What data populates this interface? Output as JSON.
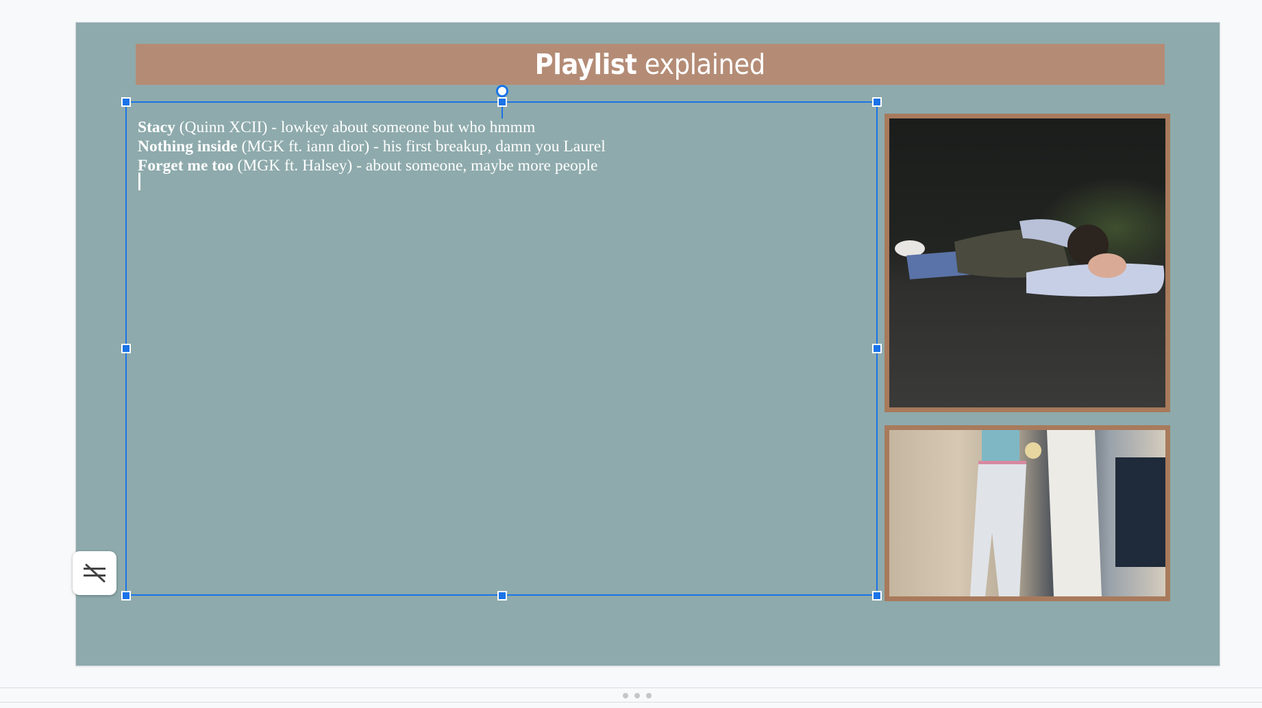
{
  "slide": {
    "title_bold": "Playlist",
    "title_rest": " explained",
    "title_bar_color": "#b48c76",
    "background_color": "#8eaaac"
  },
  "textbox": {
    "lines": [
      {
        "bold": "Stacy",
        "rest": " (Quinn XCII) - lowkey about someone but who hmmm"
      },
      {
        "bold": "Nothing inside",
        "rest": " (MGK ft. iann dior) - his first breakup, damn you Laurel"
      },
      {
        "bold": "Forget me too",
        "rest": " (MGK ft. Halsey) - about someone, maybe more people"
      }
    ],
    "selection_color": "#1a73e8"
  },
  "images": {
    "photo1": "photo-person-lying-on-road",
    "photo2": "photo-people-holding-hands",
    "frame_color": "#a87a5c"
  },
  "floating_button": {
    "icon": "clear-formatting-icon"
  }
}
